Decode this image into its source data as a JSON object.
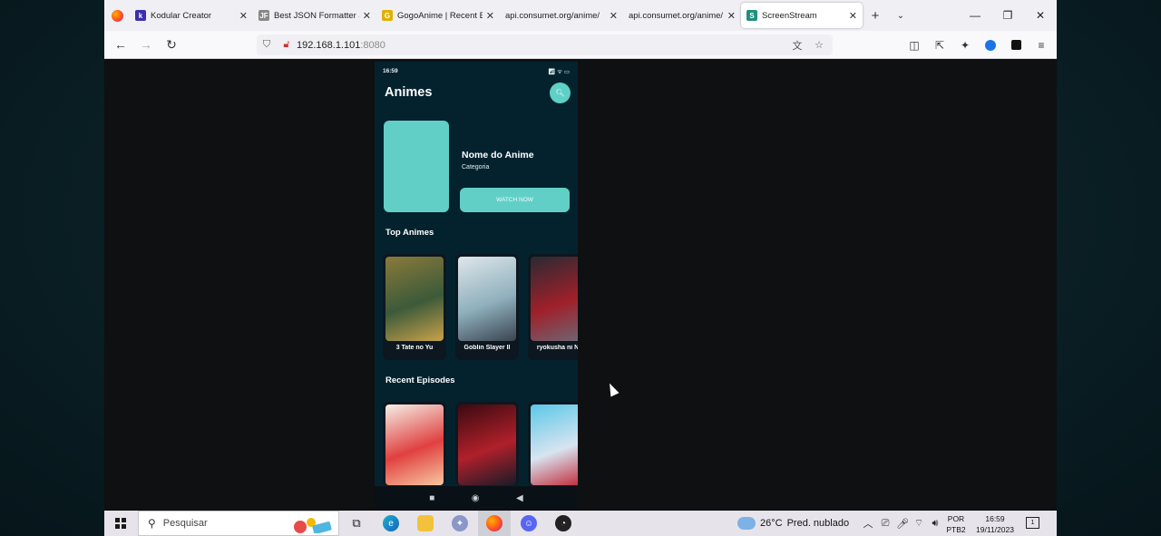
{
  "browser": {
    "tabs": [
      {
        "title": "Kodular Creator",
        "favicon": "kodular-icon",
        "favicon_text": "k",
        "color": "#3a2fb0",
        "active": false
      },
      {
        "title": "Best JSON Formatter a",
        "favicon": "json-formatter-icon",
        "favicon_text": "JF",
        "color": "#888888",
        "active": false
      },
      {
        "title": "GogoAnime | Recent E",
        "favicon": "gogoanime-icon",
        "favicon_text": "G",
        "color": "#e0b000",
        "active": false
      },
      {
        "title": "api.consumet.org/anime/",
        "favicon": "",
        "favicon_text": "",
        "color": "",
        "active": false
      },
      {
        "title": "api.consumet.org/anime/",
        "favicon": "",
        "favicon_text": "",
        "color": "",
        "active": false
      },
      {
        "title": "ScreenStream",
        "favicon": "screenstream-icon",
        "favicon_text": "S",
        "color": "#1f8f7a",
        "active": true
      }
    ],
    "url_host": "192.168.1.101",
    "url_port": ":8080"
  },
  "phone": {
    "status_time": "16:59",
    "app_title": "Animes",
    "featured": {
      "name": "Nome do Anime",
      "category": "Categoria",
      "button_label": "WATCH NOW"
    },
    "top_section_title": "Top Animes",
    "top_animes": [
      {
        "title": "3       Tate no Yu",
        "colors": [
          "#8a7a3a",
          "#3c5a3a",
          "#c9a24a"
        ]
      },
      {
        "title": "Goblin Slayer II",
        "colors": [
          "#dfe6ea",
          "#8fb0bd",
          "#3a4450"
        ]
      },
      {
        "title": "ryokusha ni Na",
        "colors": [
          "#2a2a32",
          "#a0202a",
          "#6a6a78"
        ]
      }
    ],
    "recent_section_title": "Recent Episodes",
    "recent_episodes": [
      {
        "colors": [
          "#f5f0e6",
          "#e04040",
          "#f7c8a0"
        ]
      },
      {
        "colors": [
          "#3a0a10",
          "#b0202a",
          "#1a1a28"
        ]
      },
      {
        "colors": [
          "#5ac8e8",
          "#d8e4f0",
          "#c02030"
        ]
      }
    ],
    "navkeys": [
      "■",
      "◉",
      "◀"
    ]
  },
  "taskbar": {
    "search_placeholder": "Pesquisar",
    "weather_temp": "26°C",
    "weather_desc": "Pred. nublado",
    "lang_line1": "POR",
    "lang_line2": "PTB2",
    "time": "16:59",
    "date": "19/11/2023",
    "notification_count": "1"
  }
}
